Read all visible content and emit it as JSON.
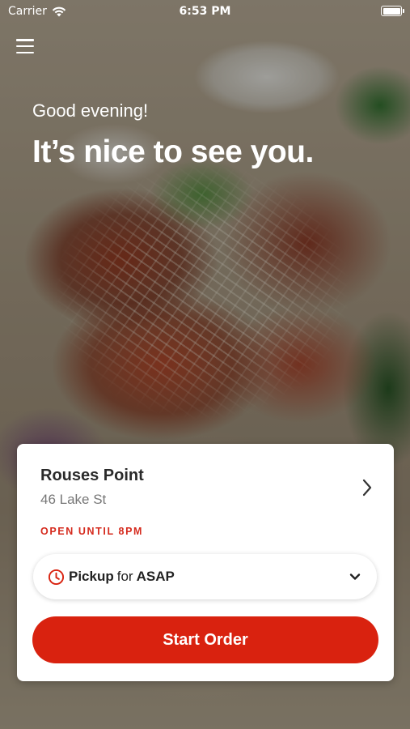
{
  "status_bar": {
    "carrier": "Carrier",
    "time": "6:53 PM"
  },
  "greeting": "Good evening!",
  "headline": "It’s nice to see you.",
  "store": {
    "name": "Rouses Point",
    "address": "46 Lake St",
    "hours": "OPEN UNTIL 8PM"
  },
  "order_mode": {
    "method": "Pickup",
    "connector": "for",
    "time": "ASAP"
  },
  "start_order_label": "Start Order",
  "colors": {
    "accent": "#d9220f",
    "hours_text": "#d52b1e"
  },
  "icons": [
    "wifi-icon",
    "battery-icon",
    "menu-icon",
    "chevron-right-icon",
    "clock-icon",
    "chevron-down-icon"
  ]
}
